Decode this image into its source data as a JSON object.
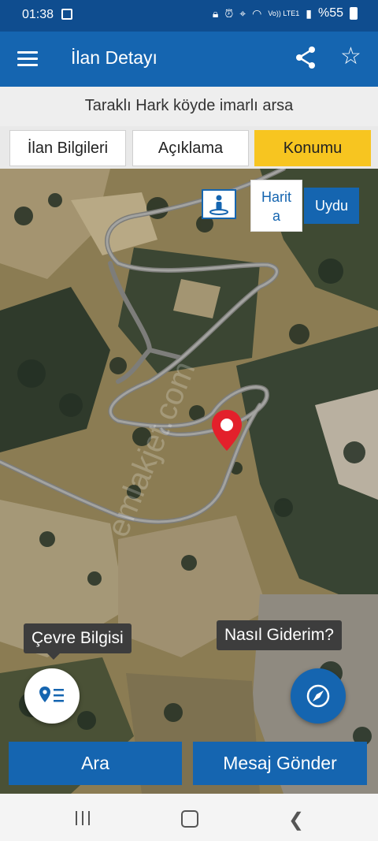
{
  "status": {
    "time": "01:38",
    "network": "Vo)) LTE1",
    "battery": "%55"
  },
  "appbar": {
    "title": "İlan Detayı",
    "menu_icon": "hamburger-icon",
    "share_icon": "share-icon",
    "star_icon": "star-icon"
  },
  "listing": {
    "title": "Taraklı Hark köyde imarlı arsa"
  },
  "tabs": [
    {
      "label": "İlan Bilgileri",
      "active": false
    },
    {
      "label": "Açıklama",
      "active": false
    },
    {
      "label": "Konumu",
      "active": true
    }
  ],
  "map": {
    "mode_toggle": {
      "harita": "Harit\na",
      "uydu": "Uydu",
      "selected": "Uydu"
    },
    "watermark": "emlakjet.com",
    "cevre_label": "Çevre Bilgisi",
    "directions_label": "Nasıl Giderim?",
    "pin_color": "#e3202b"
  },
  "actions": {
    "call": "Ara",
    "message": "Mesaj Gönder"
  },
  "colors": {
    "primary": "#1565b0",
    "accent": "#f7c520",
    "statusbar": "#0f4d8f"
  }
}
